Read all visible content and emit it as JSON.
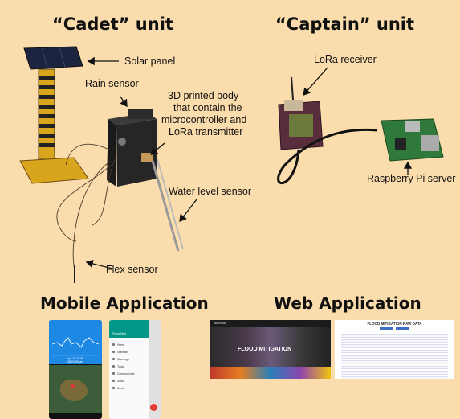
{
  "titles": {
    "cadet": "“Cadet” unit",
    "captain": "“Captain” unit",
    "mobile": "Mobile Application",
    "web": "Web Application"
  },
  "labels": {
    "solar_panel": "Solar panel",
    "rain_sensor": "Rain sensor",
    "body_line1": "3D printed body",
    "body_line2": "that contain the",
    "body_line3": "microcontroller and",
    "body_line4": "LoRa transmitter",
    "water_level": "Water level sensor",
    "flex_sensor": "Flex sensor",
    "lora_receiver": "LoRa receiver",
    "raspberry": "Raspberry Pi server"
  },
  "mobile": {
    "graph_date": "Apr 26 2018",
    "graph_time": "08:23:45 pm",
    "menu_items": [
      "Home",
      "Statistics",
      "Warnings",
      "Tools",
      "Communicate",
      "Share",
      "Send"
    ],
    "header_text": "Flood Alert"
  },
  "web": {
    "brand": "Watchdoll",
    "hero_title": "FLOOD MITIGATION",
    "table_title": "FLOOD MITIGATION RAW DATA"
  },
  "colors": {
    "background": "#fbdcac",
    "app_blue": "#1e88e5",
    "app_teal": "#009688",
    "hero_dark": "#1b1b1b"
  }
}
